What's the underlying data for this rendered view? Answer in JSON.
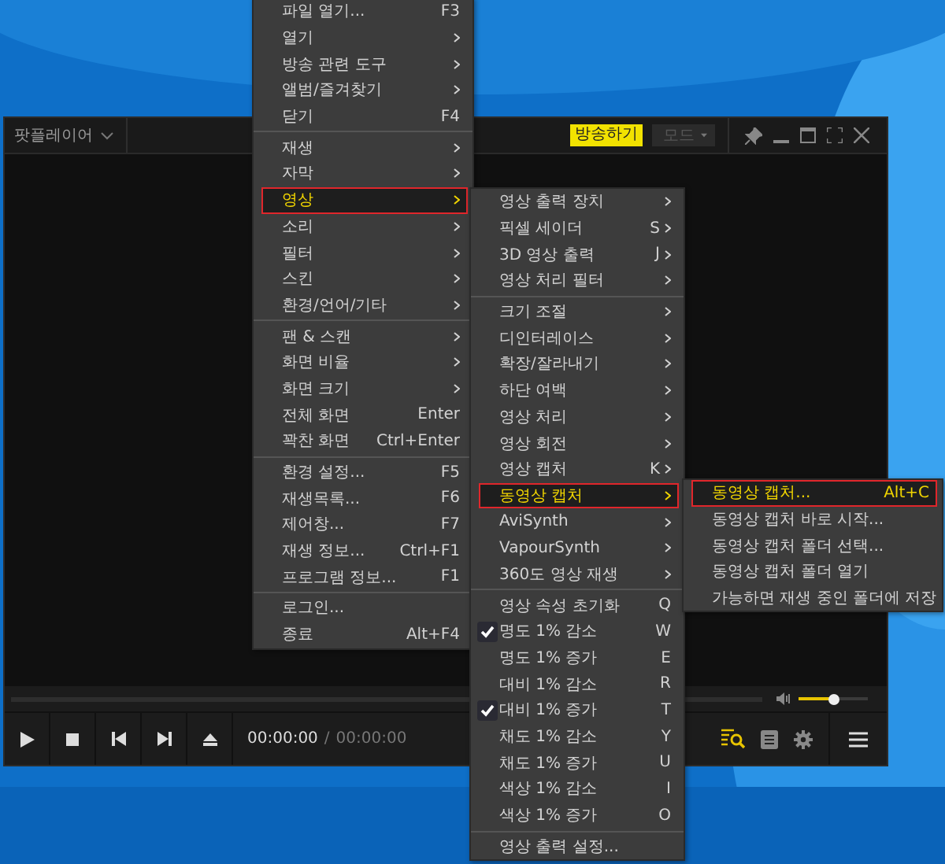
{
  "player": {
    "title": "팟플레이어",
    "broadcast_button": "방송하기",
    "mode_dropdown": "모드",
    "volume": {
      "level": 0.5
    },
    "time_current": "00:00:00",
    "time_separator": "/",
    "time_total": "00:00:00"
  },
  "main_menu": {
    "groups": [
      [
        {
          "label": "파일 열기...",
          "shortcut": "F3",
          "submenu": false,
          "selected": false
        },
        {
          "label": "열기",
          "submenu": true,
          "selected": false
        },
        {
          "label": "방송 관련 도구",
          "submenu": true,
          "selected": false
        },
        {
          "label": "앨범/즐겨찾기",
          "submenu": true,
          "selected": false
        },
        {
          "label": "닫기",
          "shortcut": "F4",
          "submenu": false,
          "selected": false
        }
      ],
      [
        {
          "label": "재생",
          "submenu": true,
          "selected": false
        },
        {
          "label": "자막",
          "submenu": true,
          "selected": false
        },
        {
          "label": "영상",
          "submenu": true,
          "selected": true
        },
        {
          "label": "소리",
          "submenu": true,
          "selected": false
        },
        {
          "label": "필터",
          "submenu": true,
          "selected": false
        },
        {
          "label": "스킨",
          "submenu": true,
          "selected": false
        },
        {
          "label": "환경/언어/기타",
          "submenu": true,
          "selected": false
        }
      ],
      [
        {
          "label": "팬 & 스캔",
          "submenu": true,
          "selected": false
        },
        {
          "label": "화면 비율",
          "submenu": true,
          "selected": false
        },
        {
          "label": "화면 크기",
          "submenu": true,
          "selected": false
        },
        {
          "label": "전체 화면",
          "shortcut": "Enter",
          "submenu": false,
          "selected": false
        },
        {
          "label": "꽉찬 화면",
          "shortcut": "Ctrl+Enter",
          "submenu": false,
          "selected": false
        }
      ],
      [
        {
          "label": "환경 설정...",
          "shortcut": "F5",
          "submenu": false,
          "selected": false
        },
        {
          "label": "재생목록...",
          "shortcut": "F6",
          "submenu": false,
          "selected": false
        },
        {
          "label": "제어창...",
          "shortcut": "F7",
          "submenu": false,
          "selected": false
        },
        {
          "label": "재생 정보...",
          "shortcut": "Ctrl+F1",
          "submenu": false,
          "selected": false
        },
        {
          "label": "프로그램 정보...",
          "shortcut": "F1",
          "submenu": false,
          "selected": false
        }
      ],
      [
        {
          "label": "로그인...",
          "submenu": false,
          "selected": false
        },
        {
          "label": "종료",
          "shortcut": "Alt+F4",
          "submenu": false,
          "selected": false
        }
      ]
    ]
  },
  "video_menu": {
    "groups": [
      [
        {
          "label": "영상 출력 장치",
          "submenu": true,
          "selected": false,
          "checked": false
        },
        {
          "label": "픽셀 세이더",
          "shortcut": "S",
          "submenu": true,
          "selected": false,
          "checked": false
        },
        {
          "label": "3D 영상 출력",
          "shortcut": "J",
          "submenu": true,
          "selected": false,
          "checked": false
        },
        {
          "label": "영상 처리 필터",
          "submenu": true,
          "selected": false,
          "checked": false
        }
      ],
      [
        {
          "label": "크기 조절",
          "submenu": true,
          "selected": false,
          "checked": false
        },
        {
          "label": "디인터레이스",
          "submenu": true,
          "selected": false,
          "checked": false
        },
        {
          "label": "확장/잘라내기",
          "submenu": true,
          "selected": false,
          "checked": false
        },
        {
          "label": "하단 여백",
          "submenu": true,
          "selected": false,
          "checked": false
        },
        {
          "label": "영상 처리",
          "submenu": true,
          "selected": false,
          "checked": false
        },
        {
          "label": "영상 회전",
          "submenu": true,
          "selected": false,
          "checked": false
        },
        {
          "label": "영상 캡처",
          "shortcut": "K",
          "submenu": true,
          "selected": false,
          "checked": false
        },
        {
          "label": "동영상 캡처",
          "submenu": true,
          "selected": true,
          "checked": false
        },
        {
          "label": "AviSynth",
          "submenu": true,
          "selected": false,
          "checked": false
        },
        {
          "label": "VapourSynth",
          "submenu": true,
          "selected": false,
          "checked": false
        },
        {
          "label": "360도 영상 재생",
          "submenu": true,
          "selected": false,
          "checked": false
        }
      ],
      [
        {
          "label": "영상 속성 초기화",
          "shortcut": "Q",
          "submenu": false,
          "selected": false,
          "checked": false
        },
        {
          "label": "명도 1% 감소",
          "shortcut": "W",
          "submenu": false,
          "selected": false,
          "checked": true
        },
        {
          "label": "명도 1% 증가",
          "shortcut": "E",
          "submenu": false,
          "selected": false,
          "checked": false
        },
        {
          "label": "대비 1% 감소",
          "shortcut": "R",
          "submenu": false,
          "selected": false,
          "checked": false
        },
        {
          "label": "대비 1% 증가",
          "shortcut": "T",
          "submenu": false,
          "selected": false,
          "checked": true
        },
        {
          "label": "채도 1% 감소",
          "shortcut": "Y",
          "submenu": false,
          "selected": false,
          "checked": false
        },
        {
          "label": "채도 1% 증가",
          "shortcut": "U",
          "submenu": false,
          "selected": false,
          "checked": false
        },
        {
          "label": "색상 1% 감소",
          "shortcut": "I",
          "submenu": false,
          "selected": false,
          "checked": false
        },
        {
          "label": "색상 1% 증가",
          "shortcut": "O",
          "submenu": false,
          "selected": false,
          "checked": false
        }
      ],
      [
        {
          "label": "영상 출력 설정...",
          "submenu": false,
          "selected": false,
          "checked": false
        }
      ]
    ]
  },
  "capture_menu": {
    "groups": [
      [
        {
          "label": "동영상 캡처...",
          "shortcut": "Alt+C",
          "submenu": false,
          "selected": true
        },
        {
          "label": "동영상 캡처 바로 시작...",
          "submenu": false,
          "selected": false
        },
        {
          "label": "동영상 캡처 폴더 선택...",
          "submenu": false,
          "selected": false
        },
        {
          "label": "동영상 캡처 폴더 열기",
          "submenu": false,
          "selected": false
        },
        {
          "label": "가능하면 재생 중인 폴더에 저장",
          "submenu": false,
          "selected": false
        }
      ]
    ]
  }
}
